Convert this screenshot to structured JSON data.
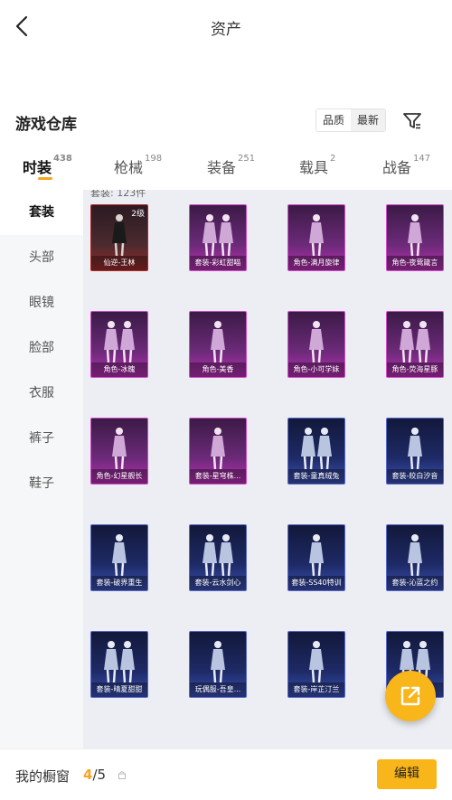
{
  "header": {
    "title": "资产",
    "back_icon": "chevron-left-icon"
  },
  "section": {
    "title": "游戏仓库",
    "sort_options": [
      "品质",
      "最新"
    ],
    "filter_icon": "funnel-icon"
  },
  "tabs": [
    {
      "label": "时装",
      "count": "438"
    },
    {
      "label": "枪械",
      "count": "198"
    },
    {
      "label": "装备",
      "count": "251"
    },
    {
      "label": "载具",
      "count": "2"
    },
    {
      "label": "战备",
      "count": "147"
    }
  ],
  "sidebar": {
    "items": [
      "套装",
      "头部",
      "眼镜",
      "脸部",
      "衣服",
      "裤子",
      "鞋子"
    ]
  },
  "content": {
    "count_label": "套装: 123件",
    "items": [
      {
        "name": "仙逆-王林",
        "rarity": "red",
        "badge": "2级"
      },
      {
        "name": "套装-彩虹甜喵",
        "rarity": "purple"
      },
      {
        "name": "角色-满月旋律",
        "rarity": "purple"
      },
      {
        "name": "角色-夜莺箴言",
        "rarity": "purple"
      },
      {
        "name": "角色-冰魄",
        "rarity": "purple"
      },
      {
        "name": "角色-美香",
        "rarity": "purple"
      },
      {
        "name": "角色-小可学妹",
        "rarity": "purple"
      },
      {
        "name": "角色-荧海星豚",
        "rarity": "purple"
      },
      {
        "name": "角色-幻星舰长",
        "rarity": "purple"
      },
      {
        "name": "套装-星穹株...",
        "rarity": "purple"
      },
      {
        "name": "套装-童真绒兔",
        "rarity": "blue"
      },
      {
        "name": "套装-皎白汐音",
        "rarity": "blue"
      },
      {
        "name": "套装-破界重生",
        "rarity": "blue"
      },
      {
        "name": "套装-云水剑心",
        "rarity": "blue"
      },
      {
        "name": "套装-SS40特训",
        "rarity": "blue"
      },
      {
        "name": "套装-沁蓝之约",
        "rarity": "blue"
      },
      {
        "name": "套装-晴夏甜甜",
        "rarity": "blue"
      },
      {
        "name": "玩偶服-吾皇...",
        "rarity": "blue"
      },
      {
        "name": "套装-岸芷汀兰",
        "rarity": "blue"
      },
      {
        "name": "套装-...",
        "rarity": "blue"
      }
    ]
  },
  "fab": {
    "icon": "share-external-icon"
  },
  "footer": {
    "label": "我的橱窗",
    "count_current": "4",
    "count_total": "/5",
    "edit_label": "编辑"
  },
  "colors": {
    "accent": "#f8b61a",
    "red_rarity": "#b32a2a",
    "purple_rarity": "#d04ac9",
    "blue_rarity": "#5767c9"
  }
}
